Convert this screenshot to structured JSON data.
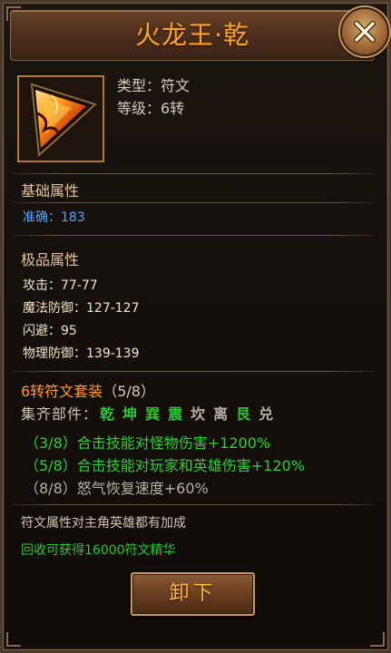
{
  "window": {
    "title": "火龙王·乾"
  },
  "item": {
    "icon_name": "fire-dragon-rune-icon",
    "type_line": "类型：符文",
    "level_line": "等级：6转"
  },
  "basic": {
    "heading": "基础属性",
    "stats": [
      {
        "text": "准确：183"
      }
    ]
  },
  "premium": {
    "heading": "极品属性",
    "stats": [
      {
        "text": "攻击：77-77"
      },
      {
        "text": "魔法防御：127-127"
      },
      {
        "text": "闪避：95"
      },
      {
        "text": "物理防御：139-139"
      }
    ]
  },
  "set": {
    "name": "6转符文套装",
    "count": "（5/8）",
    "parts_label": "集齐部件：",
    "parts": [
      {
        "name": "乾",
        "collected": true
      },
      {
        "name": "坤",
        "collected": true
      },
      {
        "name": "巽",
        "collected": true
      },
      {
        "name": "震",
        "collected": true
      },
      {
        "name": "坎",
        "collected": false
      },
      {
        "name": "离",
        "collected": false
      },
      {
        "name": "艮",
        "collected": true
      },
      {
        "name": "兑",
        "collected": false
      }
    ],
    "effects": [
      {
        "text": "（3/8）合击技能对怪物伤害+1200%",
        "active": true
      },
      {
        "text": "（5/8）合击技能对玩家和英雄伤害+120%",
        "active": true
      },
      {
        "text": "（8/8）怒气恢复速度+60%",
        "active": false
      }
    ]
  },
  "notes": {
    "inherit": "符文属性对主角英雄都有加成",
    "recycle": "回收可获得16000符文精华"
  },
  "buttons": {
    "unequip": "卸下"
  },
  "colors": {
    "title": "#ffa425",
    "accent_orange": "#ff9a28",
    "active_green": "#25c82e",
    "stat_blue": "#4aa8ff",
    "inactive_gray": "#b9b1a6"
  }
}
